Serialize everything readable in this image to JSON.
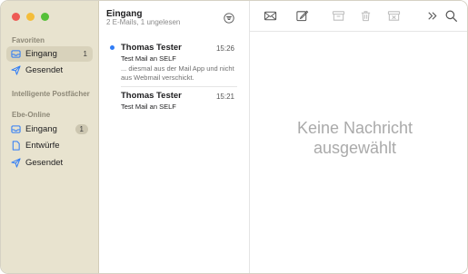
{
  "sidebar": {
    "favorites_title": "Favoriten",
    "favorites": [
      {
        "label": "Eingang",
        "icon": "inbox-icon",
        "count": "1",
        "selected": true
      },
      {
        "label": "Gesendet",
        "icon": "paperplane-icon",
        "count": "",
        "selected": false
      }
    ],
    "smart_title": "Intelligente Postfächer",
    "account_title": "Ebe-Online",
    "account": [
      {
        "label": "Eingang",
        "icon": "inbox-icon",
        "count": "1"
      },
      {
        "label": "Entwürfe",
        "icon": "document-icon",
        "count": ""
      },
      {
        "label": "Gesendet",
        "icon": "paperplane-icon",
        "count": ""
      }
    ]
  },
  "list": {
    "title": "Eingang",
    "subtitle": "2 E-Mails, 1 ungelesen",
    "messages": [
      {
        "sender": "Thomas Tester",
        "time": "15:26",
        "subject": "Test Mail an SELF",
        "preview": "... diesmal aus der Mail App und nicht aus Webmail verschickt.",
        "unread": true
      },
      {
        "sender": "Thomas Tester",
        "time": "15:21",
        "subject": "Test Mail an SELF",
        "preview": "",
        "unread": false
      }
    ]
  },
  "detail": {
    "empty_line1": "Keine Nachricht",
    "empty_line2": "ausgewählt"
  },
  "colors": {
    "sidebar_bg": "#e8e3cf",
    "accent_blue": "#2f7cf6"
  }
}
